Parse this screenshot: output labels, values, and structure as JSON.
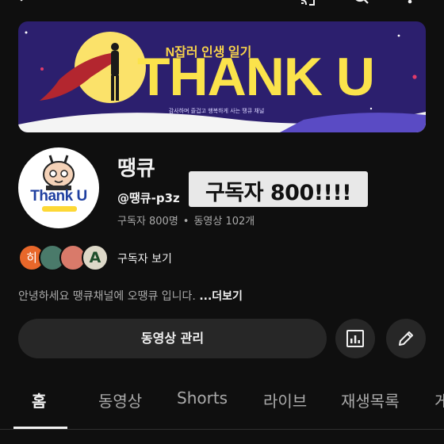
{
  "banner": {
    "subtitle": "N잡러 인생 일기",
    "title": "THANK U",
    "tagline": "감사하며 즐겁고 행복하게 사는 땡큐 채널"
  },
  "avatar": {
    "text": "Thank U"
  },
  "channel": {
    "name": "땡큐",
    "handle": "@땡큐-p3z",
    "subscribers": "구독자 800명",
    "videos": "동영상 102개",
    "overlay_text": "구독자 800!!!!"
  },
  "subscribers_row": {
    "first_initial": "히",
    "fourth_initial": "A",
    "link": "구독자 보기"
  },
  "description": {
    "text": "안녕하세요 땡큐채널에 오땡큐 입니다. ",
    "more": "...더보기"
  },
  "actions": {
    "manage": "동영상 관리"
  },
  "tabs": [
    "홈",
    "동영상",
    "Shorts",
    "라이브",
    "재생목록",
    "게"
  ],
  "colors": {
    "background": "#0f0f0f",
    "button": "#272727",
    "banner_purple": "#2c1f6e",
    "banner_yellow": "#fbe34b"
  }
}
